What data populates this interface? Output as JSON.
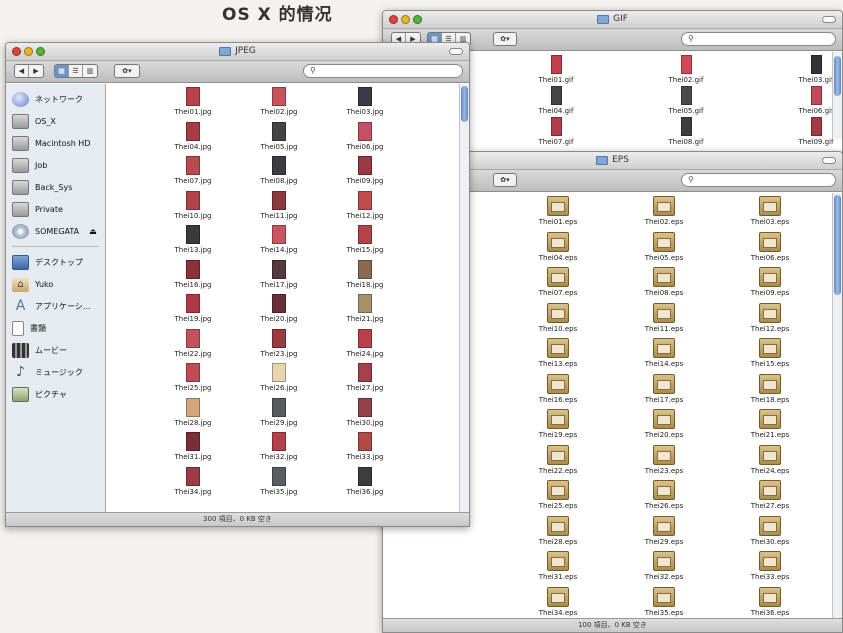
{
  "page_heading": "OS X 的情况",
  "colors": {
    "selected_view": "#6b93c7",
    "sidebar_bg": "#e6ebf1",
    "scroll_thumb": "#5d88c6"
  },
  "jpeg_window": {
    "title": "JPEG",
    "search_placeholder": "",
    "status": "300 項目、0 KB 空き",
    "sidebar": {
      "places": [
        {
          "label": "ネットワーク",
          "icon": "network-globe-icon"
        },
        {
          "label": "OS_X",
          "icon": "hard-disk-icon"
        },
        {
          "label": "Macintosh HD",
          "icon": "hard-disk-icon"
        },
        {
          "label": "Job",
          "icon": "hard-disk-icon"
        },
        {
          "label": "Back_Sys",
          "icon": "hard-disk-icon"
        },
        {
          "label": "Private",
          "icon": "hard-disk-icon"
        },
        {
          "label": "SOMEGATA",
          "icon": "cd-disk-icon",
          "eject": "⏏"
        }
      ],
      "folders": [
        {
          "label": "デスクトップ",
          "icon": "desktop-icon"
        },
        {
          "label": "Yuko",
          "icon": "home-icon"
        },
        {
          "label": "アプリケーシ...",
          "icon": "applications-icon"
        },
        {
          "label": "書類",
          "icon": "documents-icon"
        },
        {
          "label": "ムービー",
          "icon": "movies-icon"
        },
        {
          "label": "ミュージック",
          "icon": "music-icon"
        },
        {
          "label": "ピクチャ",
          "icon": "pictures-icon"
        }
      ]
    },
    "files": [
      {
        "name": "Thei01.jpg",
        "color": "#b8444a"
      },
      {
        "name": "Thei02.jpg",
        "color": "#c6545a"
      },
      {
        "name": "Thei03.jpg",
        "color": "#3a3a44"
      },
      {
        "name": "Thei04.jpg",
        "color": "#a83c42"
      },
      {
        "name": "Thei05.jpg",
        "color": "#444"
      },
      {
        "name": "Thei06.jpg",
        "color": "#c45064"
      },
      {
        "name": "Thei07.jpg",
        "color": "#b84a50"
      },
      {
        "name": "Thei08.jpg",
        "color": "#3c3c42"
      },
      {
        "name": "Thei09.jpg",
        "color": "#9a3a40"
      },
      {
        "name": "Thei10.jpg",
        "color": "#b04448"
      },
      {
        "name": "Thei11.jpg",
        "color": "#8a3a3e"
      },
      {
        "name": "Thei12.jpg",
        "color": "#c04c50"
      },
      {
        "name": "Thei13.jpg",
        "color": "#3a3a3a"
      },
      {
        "name": "Thei14.jpg",
        "color": "#c85660"
      },
      {
        "name": "Thei15.jpg",
        "color": "#b34246"
      },
      {
        "name": "Thei16.jpg",
        "color": "#8c3238"
      },
      {
        "name": "Thei17.jpg",
        "color": "#55393d"
      },
      {
        "name": "Thei18.jpg",
        "color": "#8a6a50"
      },
      {
        "name": "Thei19.jpg",
        "color": "#b03a44"
      },
      {
        "name": "Thei20.jpg",
        "color": "#6a3038"
      },
      {
        "name": "Thei21.jpg",
        "color": "#a8906a"
      },
      {
        "name": "Thei22.jpg",
        "color": "#c4525c"
      },
      {
        "name": "Thei23.jpg",
        "color": "#9a3c42"
      },
      {
        "name": "Thei24.jpg",
        "color": "#b84048"
      },
      {
        "name": "Thei25.jpg",
        "color": "#c24a54"
      },
      {
        "name": "Thei26.jpg",
        "color": "#e6d6b0"
      },
      {
        "name": "Thei27.jpg",
        "color": "#a44048"
      },
      {
        "name": "Thei28.jpg",
        "color": "#d4a47a"
      },
      {
        "name": "Thei29.jpg",
        "color": "#555b5e"
      },
      {
        "name": "Thei30.jpg",
        "color": "#944048"
      },
      {
        "name": "Thei31.jpg",
        "color": "#7a2e38"
      },
      {
        "name": "Thei32.jpg",
        "color": "#b4424c"
      },
      {
        "name": "Thei33.jpg",
        "color": "#b14a44"
      },
      {
        "name": "Thei34.jpg",
        "color": "#a03a46"
      },
      {
        "name": "Thei35.jpg",
        "color": "#5a5e62"
      },
      {
        "name": "Thei36.jpg",
        "color": "#3c3c40"
      }
    ]
  },
  "gif_window": {
    "title": "GIF",
    "files": [
      {
        "name": "Thei01.gif",
        "color": "#c2404a"
      },
      {
        "name": "Thei02.gif",
        "color": "#d04a55"
      },
      {
        "name": "Thei03.gif",
        "color": "#33333a"
      },
      {
        "name": "Thei04.gif",
        "color": "#444"
      },
      {
        "name": "Thei05.gif",
        "color": "#4a4a4e"
      },
      {
        "name": "Thei06.gif",
        "color": "#c24a56"
      },
      {
        "name": "Thei07.gif",
        "color": "#b23c48"
      },
      {
        "name": "Thei08.gif",
        "color": "#3e3e42"
      },
      {
        "name": "Thei09.gif",
        "color": "#a83a44"
      }
    ]
  },
  "eps_window": {
    "title": "EPS",
    "status": "100 項目、0 KB 空き",
    "files": [
      "Thei01.eps",
      "Thei02.eps",
      "Thei03.eps",
      "Thei04.eps",
      "Thei05.eps",
      "Thei06.eps",
      "Thei07.eps",
      "Thei08.eps",
      "Thei09.eps",
      "Thei10.eps",
      "Thei11.eps",
      "Thei12.eps",
      "Thei13.eps",
      "Thei14.eps",
      "Thei15.eps",
      "Thei16.eps",
      "Thei17.eps",
      "Thei18.eps",
      "Thei19.eps",
      "Thei20.eps",
      "Thei21.eps",
      "Thei22.eps",
      "Thei23.eps",
      "Thei24.eps",
      "Thei25.eps",
      "Thei26.eps",
      "Thei27.eps",
      "Thei28.eps",
      "Thei29.eps",
      "Thei30.eps",
      "Thei31.eps",
      "Thei32.eps",
      "Thei33.eps",
      "Thei34.eps",
      "Thei35.eps",
      "Thei36.eps"
    ]
  }
}
